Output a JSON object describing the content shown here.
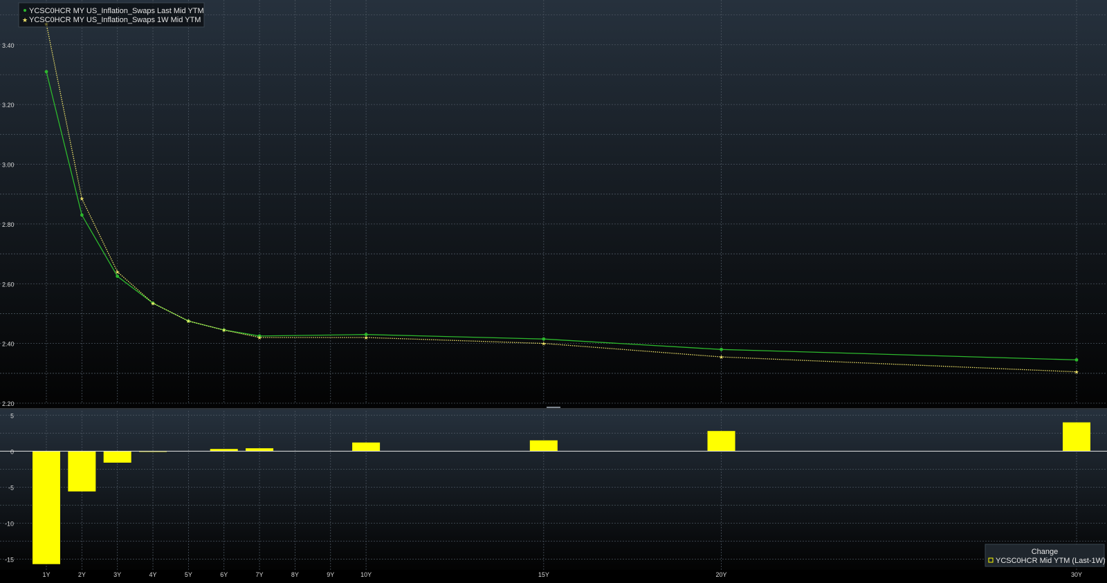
{
  "chart_data": [
    {
      "type": "line",
      "tenors": [
        "1Y",
        "2Y",
        "3Y",
        "4Y",
        "5Y",
        "6Y",
        "7Y",
        "8Y",
        "9Y",
        "10Y",
        "15Y",
        "20Y",
        "30Y"
      ],
      "x_years": [
        1,
        2,
        3,
        4,
        5,
        6,
        7,
        8,
        9,
        10,
        15,
        20,
        30
      ],
      "ylim": [
        2.2,
        3.55
      ],
      "yticks": [
        "3.40",
        "3.20",
        "3.00",
        "2.80",
        "2.60",
        "2.40",
        "2.20"
      ],
      "grid": true,
      "legend_position": "top-left",
      "series": [
        {
          "name": "YCSC0HCR MY US_Inflation_Swaps Last Mid YTM",
          "color": "#2db82d",
          "marker": "dot",
          "line_style": "solid",
          "points": [
            [
              1,
              3.31
            ],
            [
              2,
              2.83
            ],
            [
              3,
              2.625
            ],
            [
              4,
              2.535
            ],
            [
              5,
              2.475
            ],
            [
              6,
              2.445
            ],
            [
              7,
              2.425
            ],
            [
              10,
              2.43
            ],
            [
              15,
              2.415
            ],
            [
              20,
              2.38
            ],
            [
              30,
              2.345
            ]
          ]
        },
        {
          "name": "YCSC0HCR MY US_Inflation_Swaps 1W Mid YTM",
          "color": "#f2e66b",
          "marker": "star",
          "line_style": "dotted",
          "points": [
            [
              1,
              3.47
            ],
            [
              2,
              2.885
            ],
            [
              3,
              2.64
            ],
            [
              4,
              2.535
            ],
            [
              5,
              2.475
            ],
            [
              6,
              2.445
            ],
            [
              7,
              2.42
            ],
            [
              10,
              2.42
            ],
            [
              15,
              2.4
            ],
            [
              20,
              2.355
            ],
            [
              30,
              2.305
            ]
          ]
        }
      ]
    },
    {
      "type": "bar",
      "ylim": [
        -16.5,
        5.8
      ],
      "yticks": [
        "5",
        "0",
        "-5",
        "-10",
        "-15"
      ],
      "color": "#ffff00",
      "legend_title": "Change",
      "legend_label": "YCSC0HCR Mid YTM (Last-1W)",
      "legend_position": "bottom-right",
      "bars": [
        [
          1,
          -15.7
        ],
        [
          2,
          -5.6
        ],
        [
          3,
          -1.6
        ],
        [
          4,
          -0.1
        ],
        [
          6,
          0.3
        ],
        [
          7,
          0.4
        ],
        [
          10,
          1.2
        ],
        [
          15,
          1.5
        ],
        [
          20,
          2.8
        ],
        [
          30,
          4.0
        ]
      ]
    }
  ]
}
